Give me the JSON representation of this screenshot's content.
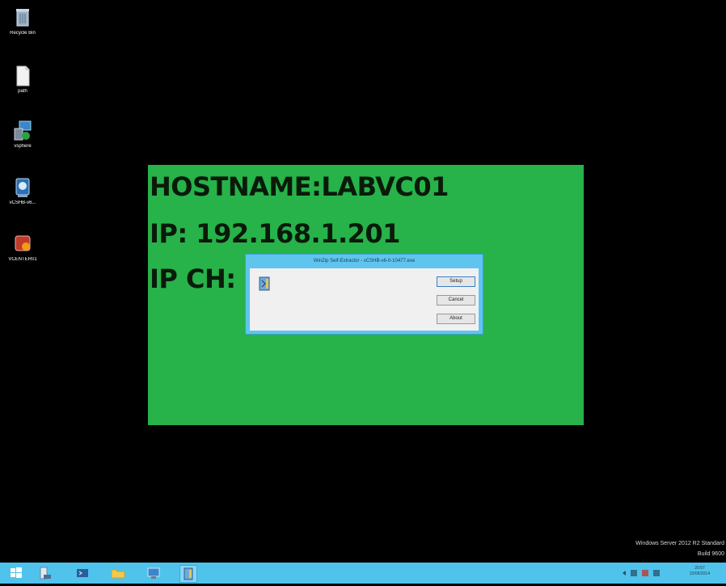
{
  "desktop_icons": [
    {
      "label": "Recycle Bin",
      "icon": "recycle-bin-icon"
    },
    {
      "label": "path",
      "icon": "file-icon"
    },
    {
      "label": "vsphere",
      "icon": "network-computer-icon"
    },
    {
      "label": "vCSHB-v6...",
      "icon": "installer-icon"
    },
    {
      "label": "VCENTER01",
      "icon": "vcenter-icon"
    }
  ],
  "wallpaper": {
    "hostname": "HOSTNAME:LABVC01",
    "ip": "IP: 192.168.1.201",
    "ip_ch": "IP CH:",
    "color": "#27b24a"
  },
  "dialog": {
    "title": "WinZip Self-Extractor - vCSHB-v6-0-10477.exe",
    "buttons": {
      "setup": "Setup",
      "cancel": "Cancel",
      "about": "About"
    }
  },
  "watermark": {
    "line1": "Windows Server 2012 R2 Standard",
    "line2": "Build 9600"
  },
  "taskbar": {
    "color": "#4fc3ec",
    "clock_time": "20:57",
    "clock_date": "22/06/2014"
  }
}
